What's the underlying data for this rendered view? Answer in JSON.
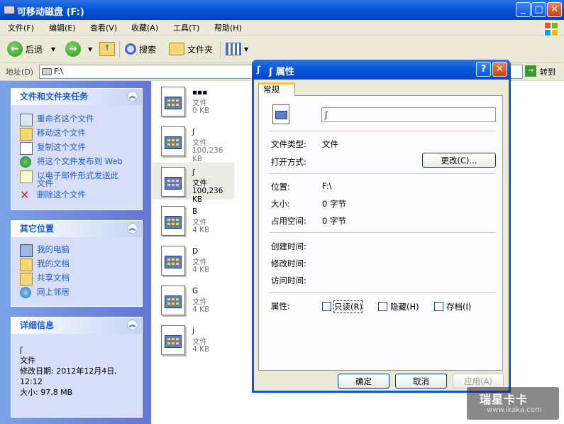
{
  "window": {
    "title": "可移动磁盘 (F:)",
    "min": "_",
    "max": "□",
    "close": "✕"
  },
  "menu": [
    "文件(F)",
    "编辑(E)",
    "查看(V)",
    "收藏(A)",
    "工具(T)",
    "帮助(H)"
  ],
  "toolbar": {
    "back": "后退",
    "search": "搜索",
    "folders": "文件夹"
  },
  "address": {
    "label": "地址(D)",
    "value": "F:\\",
    "go": "转到"
  },
  "tasks_panel": {
    "title": "文件和文件夹任务",
    "items": [
      "重命名这个文件",
      "移动这个文件",
      "复制这个文件",
      "将这个文件发布到 Web",
      "以电子邮件形式发送此",
      "文件",
      "删除这个文件"
    ]
  },
  "places_panel": {
    "title": "其它位置",
    "items": [
      "我的电脑",
      "我的文档",
      "共享文档",
      "网上邻居"
    ]
  },
  "details_panel": {
    "title": "详细信息",
    "name": "ʃ",
    "type": "文件",
    "modified_label": "修改日期: 2012年12月4日,",
    "modified_time": "12:12",
    "size": "大小: 97.8 MB"
  },
  "files": [
    {
      "name": "▪▪▪",
      "type": "文件",
      "size": "0 KB"
    },
    {
      "name": "ʃ",
      "type": "文件",
      "size": "100,236 KB"
    },
    {
      "name": "ʃ",
      "type": "文件",
      "size": "100,236 KB"
    },
    {
      "name": "B",
      "type": "文件",
      "size": "4 KB"
    },
    {
      "name": "D",
      "type": "文件",
      "size": "4 KB"
    },
    {
      "name": "G",
      "type": "文件",
      "size": "4 KB"
    },
    {
      "name": "j",
      "type": "文件",
      "size": "4 KB"
    }
  ],
  "dialog": {
    "title": "ʃ 属性",
    "help": "?",
    "close": "✕",
    "tab": "常规",
    "filename": "ʃ",
    "type_label": "文件类型:",
    "type_value": "文件",
    "open_label": "打开方式:",
    "change_button": "更改(C)...",
    "location_label": "位置:",
    "location_value": "F:\\",
    "size_label": "大小:",
    "size_value": "0 字节",
    "disk_label": "占用空间:",
    "disk_value": "0 字节",
    "created_label": "创建时间:",
    "modified_label": "修改时间:",
    "accessed_label": "访问时间:",
    "attr_label": "属性:",
    "readonly": "只读(R)",
    "hidden": "隐藏(H)",
    "archive": "存档(I)",
    "ok": "确定",
    "cancel": "取消",
    "apply": "应用(A)"
  },
  "watermark": {
    "brand": "瑞星卡卡",
    "url": "www.ikaka.com"
  }
}
